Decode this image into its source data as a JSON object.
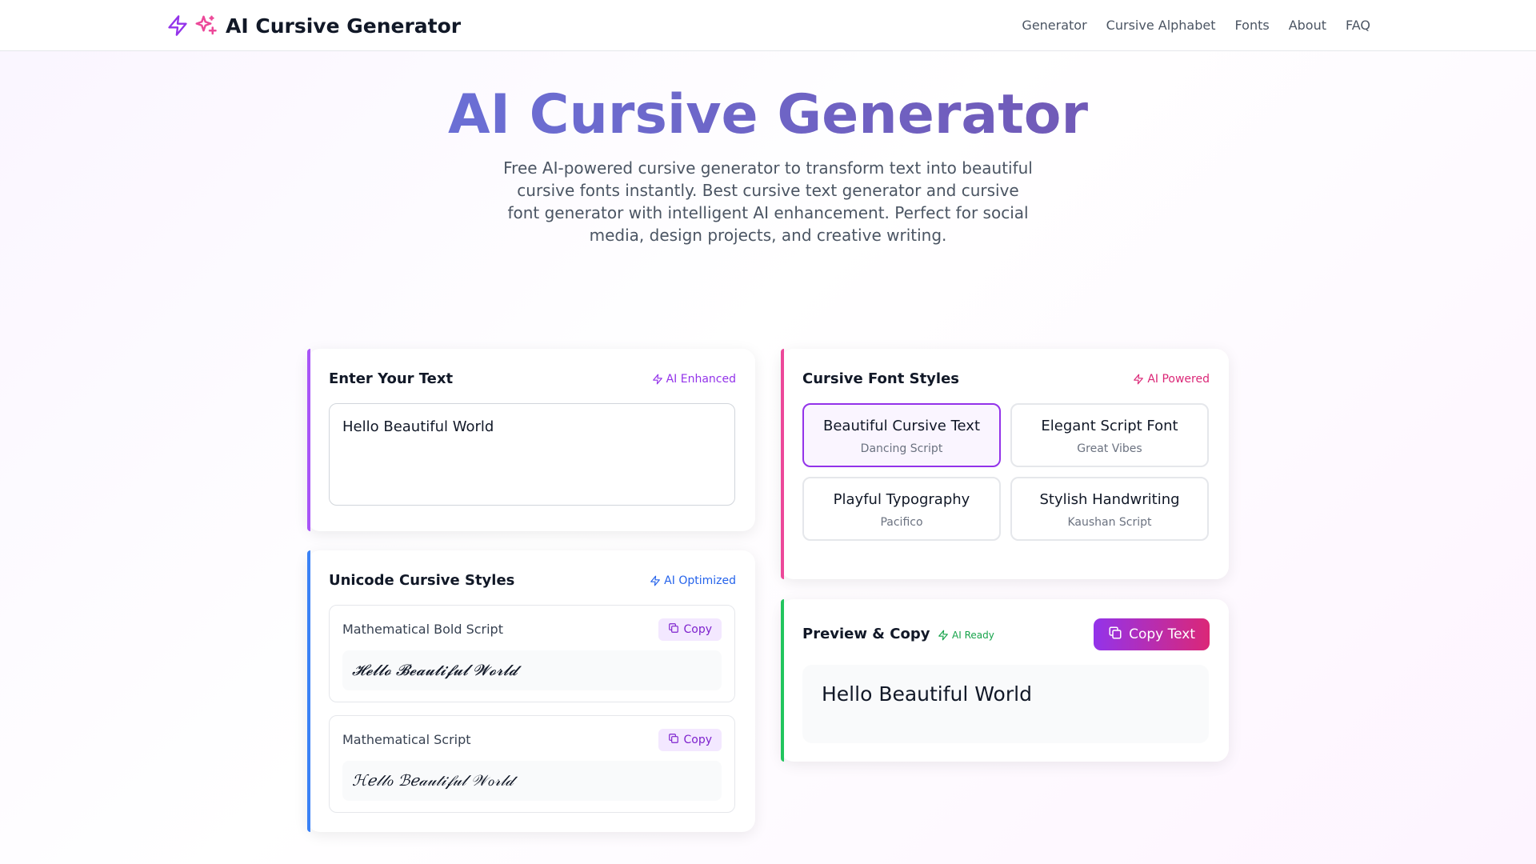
{
  "header": {
    "title": "AI Cursive Generator",
    "nav": [
      "Generator",
      "Cursive Alphabet",
      "Fonts",
      "About",
      "FAQ"
    ]
  },
  "hero": {
    "title": "AI Cursive Generator",
    "subtitle": "Free AI-powered cursive generator to transform text into beautiful cursive fonts instantly. Best cursive text generator and cursive font generator with intelligent AI enhancement. Perfect for social media, design projects, and creative writing."
  },
  "input_card": {
    "title": "Enter Your Text",
    "badge": "AI Enhanced",
    "value": "Hello Beautiful World"
  },
  "unicode_card": {
    "title": "Unicode Cursive Styles",
    "badge": "AI Optimized",
    "styles": [
      {
        "name": "Mathematical Bold Script",
        "copy_label": "Copy",
        "output": "𝓗𝓮𝓵𝓵𝓸 𝓑𝓮𝓪𝓾𝓽𝓲𝓯𝓾𝓵 𝓦𝓸𝓻𝓵𝓭"
      },
      {
        "name": "Mathematical Script",
        "copy_label": "Copy",
        "output": "ℋℯ𝓁𝓁ℴ ℬℯ𝒶𝓊𝓉𝒾𝒻𝓊𝓁 𝒲ℴ𝓇𝓁𝒹"
      }
    ]
  },
  "fonts_card": {
    "title": "Cursive Font Styles",
    "badge": "AI Powered",
    "options": [
      {
        "name": "Beautiful Cursive Text",
        "font": "Dancing Script"
      },
      {
        "name": "Elegant Script Font",
        "font": "Great Vibes"
      },
      {
        "name": "Playful Typography",
        "font": "Pacifico"
      },
      {
        "name": "Stylish Handwriting",
        "font": "Kaushan Script"
      }
    ]
  },
  "preview_card": {
    "title": "Preview & Copy",
    "badge": "AI Ready",
    "copy_label": "Copy Text",
    "text": "Hello Beautiful World"
  },
  "colors": {
    "purple": "#9333ea",
    "pink": "#db2777",
    "blue": "#2563eb",
    "green": "#16a34a"
  }
}
